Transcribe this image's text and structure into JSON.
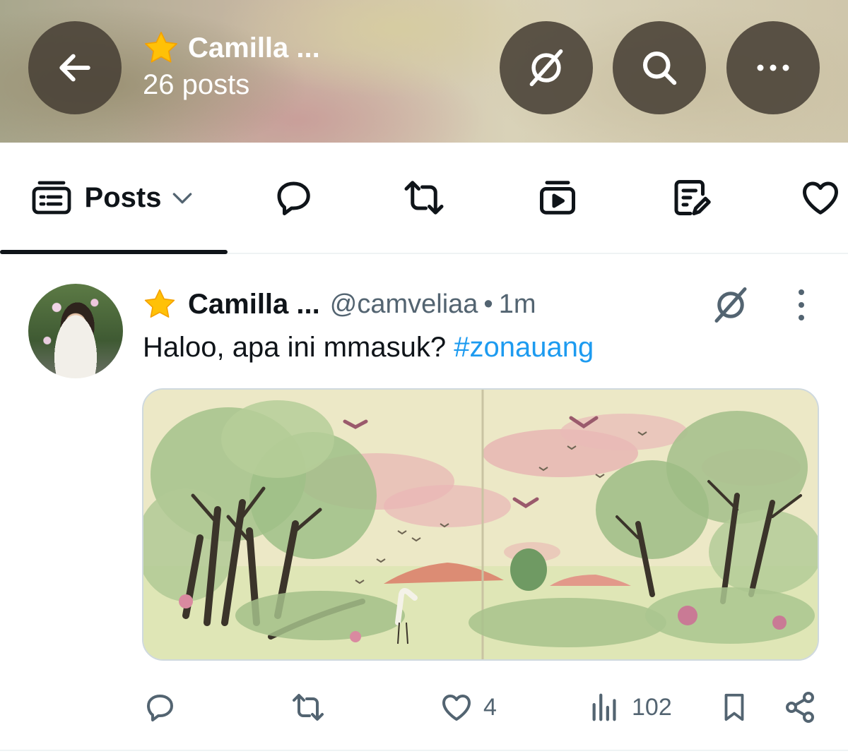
{
  "header": {
    "name": "Camilla ...",
    "post_count": "26 posts",
    "icons": [
      "back-arrow-icon",
      "grok-icon",
      "search-icon",
      "more-horizontal-icon"
    ]
  },
  "tabs": {
    "active_label": "Posts",
    "items": [
      "posts-tab-icon",
      "reply-icon",
      "repost-icon",
      "video-icon",
      "article-icon",
      "heart-icon"
    ]
  },
  "post": {
    "name": "Camilla ...",
    "handle": "@camveliaa",
    "separator": "•",
    "time": "1m",
    "text": "Haloo, apa ini mmasuk? ",
    "hashtag": "#zonauang",
    "likes": "4",
    "views": "102"
  },
  "colors": {
    "link": "#1d9bf0",
    "text_primary": "#0f1419",
    "text_secondary": "#536471",
    "header_button": "#484036",
    "star": "#ffc107"
  }
}
